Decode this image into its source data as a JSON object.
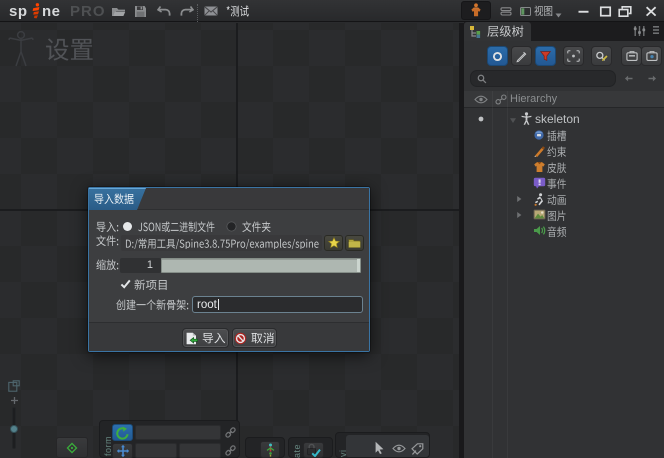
{
  "window": {
    "app_logo": "spine",
    "app_logo_left": "sp",
    "app_logo_right": "ne",
    "app_edition": "PRO",
    "project_title": "*测试",
    "toolbar_icons": [
      "open-folder",
      "save",
      "undo",
      "redo",
      "mail"
    ],
    "right_icons": [
      "spineboy-character",
      "layers",
      "view-mode"
    ],
    "view_menu_label": "视图",
    "window_controls": [
      "minimize",
      "maximize",
      "restore",
      "close"
    ]
  },
  "canvas": {
    "mode_label": "设置",
    "zoom_slider": {
      "plus_label": "+"
    },
    "checker_colors": [
      "#2b2c2e",
      "#28292a"
    ],
    "axis_color": "#1b1c1e"
  },
  "dialog": {
    "title": "导入数据",
    "import_row": {
      "label": "导入:",
      "options": [
        {
          "label": "JSON或二进制文件",
          "selected": true
        },
        {
          "label": "文件夹",
          "selected": false
        }
      ]
    },
    "file_row": {
      "label": "文件:",
      "value": "D:/常用工具/Spine3.8.75Pro/examples/spine",
      "buttons": [
        "favorite-star",
        "browse-folder"
      ]
    },
    "scale_row": {
      "label": "缩放:",
      "value": "1"
    },
    "new_project_row": {
      "label": "新项目",
      "checked": true
    },
    "skeleton_row": {
      "label": "创建一个新骨架:",
      "value": "root"
    },
    "buttons": {
      "import": "导入",
      "cancel": "取消"
    }
  },
  "hierarchy_panel": {
    "tab_label": "层级树",
    "toolbar_icons": [
      "bones-filter",
      "edit-filter",
      "filter-funnel",
      "center-selection",
      "find-replace",
      "expand-tree",
      "collapse-tree"
    ],
    "search": {
      "placeholder": "",
      "value": ""
    },
    "nav_icons": [
      "history-back",
      "history-forward"
    ],
    "header": {
      "columns": [
        "visibility",
        "link",
        "Hierarchy"
      ]
    },
    "tree": [
      {
        "label": "skeleton",
        "level": 0,
        "expanded": true,
        "active": true,
        "icon": "skeleton-figure"
      },
      {
        "label": "插槽",
        "level": 1,
        "icon": "slots"
      },
      {
        "label": "约束",
        "level": 1,
        "icon": "constraints"
      },
      {
        "label": "皮肤",
        "level": 1,
        "icon": "skins"
      },
      {
        "label": "事件",
        "level": 1,
        "icon": "events"
      },
      {
        "label": "动画",
        "level": 1,
        "expanded": false,
        "icon": "animations"
      },
      {
        "label": "图片",
        "level": 1,
        "expanded": false,
        "icon": "images"
      },
      {
        "label": "音频",
        "level": 1,
        "icon": "audio"
      }
    ]
  },
  "bottom_toolbars": {
    "transform_label_partial": "form",
    "compensate_label_partial": "ate",
    "visibility_label_partial": "vi",
    "tools": [
      "axes",
      "rotate",
      "translate",
      "pose",
      "lock-compensate",
      "cursor-visibility",
      "eye-visibility",
      "tag-visibility"
    ],
    "rotate_selected": true
  }
}
